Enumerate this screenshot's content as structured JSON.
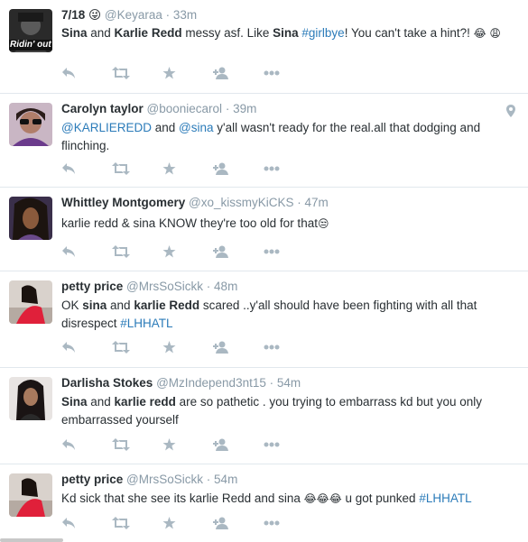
{
  "icons": {
    "reply": "reply-icon",
    "retweet": "retweet-icon",
    "favorite": "star-icon",
    "follow": "follow-user-icon",
    "more": "more-dots-icon",
    "geo": "location-pin-icon"
  },
  "colors": {
    "link": "#2b7bb9",
    "muted": "#8899a6",
    "icon": "#aab8c2",
    "divider": "#e1e8ed"
  },
  "tweets": [
    {
      "fullname": "7/18 😜",
      "username": "@Keyaraa",
      "sep": "·",
      "time": "33m",
      "avatar_text": "Ridin' out",
      "text_parts": [
        "Sina",
        " and ",
        "Karlie Redd",
        " messy asf. Like ",
        "Sina",
        " ",
        "#girlbye",
        "! You can't take a hint?! ",
        "😂",
        " ",
        "😩"
      ]
    },
    {
      "fullname": "Carolyn taylor",
      "username": "@booniecarol",
      "sep": "·",
      "time": "39m",
      "text_parts": [
        "@KARLIEREDD",
        " and ",
        "@sina",
        " y'all wasn't ready for the real.all that dodging and flinching."
      ]
    },
    {
      "fullname": "Whittley Montgomery",
      "username": "@xo_kissmyKiCKS",
      "sep": "·",
      "time": "47m",
      "text_parts": [
        "karlie redd & sina KNOW they're too old for that",
        "😒"
      ]
    },
    {
      "fullname": "petty price",
      "username": "@MrsSoSickk",
      "sep": "·",
      "time": "48m",
      "text_parts": [
        "OK ",
        "sina",
        " and ",
        "karlie Redd",
        " scared ..y'all should have been fighting with all that disrespect ",
        "#LHHATL"
      ]
    },
    {
      "fullname": "Darlisha Stokes",
      "username": "@MzIndepend3nt15",
      "sep": "·",
      "time": "54m",
      "text_parts": [
        "Sina",
        " and ",
        "karlie redd",
        " are so pathetic . you trying to embarrass kd but you only embarrassed yourself"
      ]
    },
    {
      "fullname": "petty price",
      "username": "@MrsSoSickk",
      "sep": "·",
      "time": "54m",
      "text_parts": [
        "Kd sick that she see its karlie Redd and sina ",
        "😂😂😂",
        " u got punked ",
        "#LHHATL"
      ]
    }
  ]
}
